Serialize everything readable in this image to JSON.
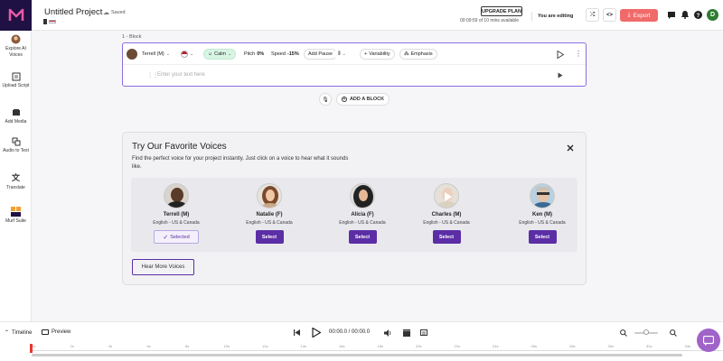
{
  "header": {
    "project_title": "Untitled Project",
    "saved": "Saved",
    "upgrade_label": "UPGRADE PLAN",
    "mins_used": "00:09:59 of 10 mins available",
    "editing_status": "You are editing",
    "export_label": "Export",
    "avatar_initial": "D"
  },
  "sidebar": {
    "items": [
      {
        "label": "Explore AI Voices",
        "icon": "avatar-icon"
      },
      {
        "label": "Upload Script",
        "icon": "upload-script-icon"
      },
      {
        "label": "Add Media",
        "icon": "media-icon"
      },
      {
        "label": "Audio to Text",
        "icon": "audio-to-text-icon"
      },
      {
        "label": "Translate",
        "icon": "translate-icon"
      },
      {
        "label": "Murf Suite",
        "icon": "murf-suite-icon"
      }
    ]
  },
  "block": {
    "label": "1 - Block",
    "voice": "Terrell (M)",
    "style": "Calm",
    "pitch_label": "Pitch",
    "pitch_value": "0%",
    "speed_label": "Speed",
    "speed_value": "-15%",
    "add_pause": "Add Pause",
    "variability": "Variability",
    "emphasis": "Emphasis",
    "placeholder": "Enter your text here"
  },
  "add_block_label": "ADD A BLOCK",
  "favorites": {
    "title": "Try Our Favorite Voices",
    "description": "Find the perfect voice for your project instantly. Just click on a voice to hear what it sounds like.",
    "hear_more": "Hear More Voices",
    "select_label": "Select",
    "selected_label": "Selected",
    "voices": [
      {
        "name": "Terrell (M)",
        "lang": "English - US & Canada",
        "selected": true
      },
      {
        "name": "Natalie (F)",
        "lang": "English - US & Canada",
        "selected": false
      },
      {
        "name": "Alicia (F)",
        "lang": "English - US & Canada",
        "selected": false
      },
      {
        "name": "Charles (M)",
        "lang": "English - US & Canada",
        "selected": false
      },
      {
        "name": "Ken (M)",
        "lang": "English - US & Canada",
        "selected": false
      }
    ]
  },
  "timeline": {
    "label": "Timeline",
    "preview": "Preview",
    "time": "00:00.0 / 00:00.0",
    "ticks": [
      "0s",
      "2s",
      "4s",
      "6s",
      "8s",
      "10s",
      "12s",
      "14s",
      "16s",
      "18s",
      "20s",
      "22s",
      "24s",
      "26s",
      "28s",
      "30s",
      "32s",
      "34s"
    ]
  },
  "colors": {
    "accent": "#5b2ea6",
    "export": "#f06a6a",
    "block_border": "#8c6de0"
  }
}
